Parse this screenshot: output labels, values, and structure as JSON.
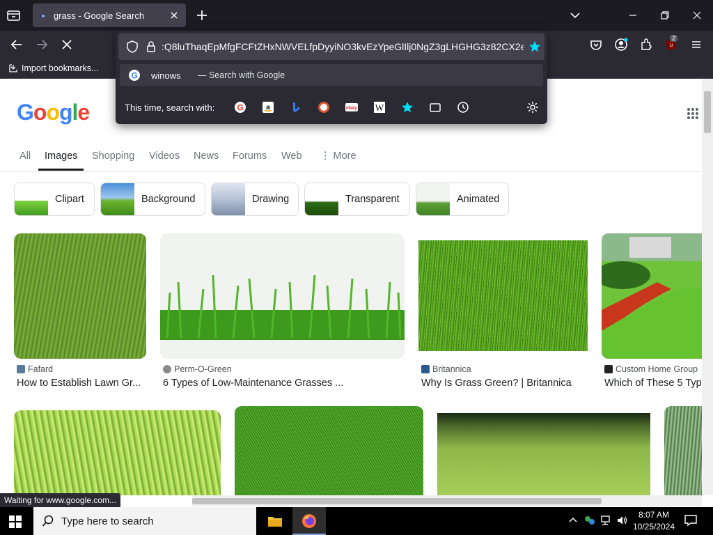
{
  "browser": {
    "tab_title": "grass - Google Search",
    "url_text": ":Q8luThaqEpMfgFCFtZHxNWVELfpDyyiNO3kvEzYpeGlIlj0NgZ3gLHGHG3z82CX2eYg",
    "bookmark_label": "Import bookmarks...",
    "status_text": "Waiting for www.google.com...",
    "notif_count": "2",
    "accent": "#00ddff"
  },
  "dropdown": {
    "suggestion_query": "winows",
    "suggestion_hint": "— Search with Google",
    "engines_label": "This time, search with:"
  },
  "google": {
    "logo": "Google",
    "tabs": [
      "All",
      "Images",
      "Shopping",
      "Videos",
      "News",
      "Forums",
      "Web",
      "More"
    ],
    "chips": [
      "Clipart",
      "Background",
      "Drawing",
      "Transparent",
      "Animated"
    ]
  },
  "results": [
    {
      "source": "Fafard",
      "title": "How to Establish Lawn Gr..."
    },
    {
      "source": "Perm-O-Green",
      "title": "6 Types of Low-Maintenance Grasses ..."
    },
    {
      "source": "Britannica",
      "title": "Why Is Grass Green? | Britannica"
    },
    {
      "source": "Custom Home Group",
      "title": "Which of These 5 Typ"
    }
  ],
  "taskbar": {
    "search_placeholder": "Type here to search",
    "time": "8:07 AM",
    "date": "10/25/2024"
  }
}
